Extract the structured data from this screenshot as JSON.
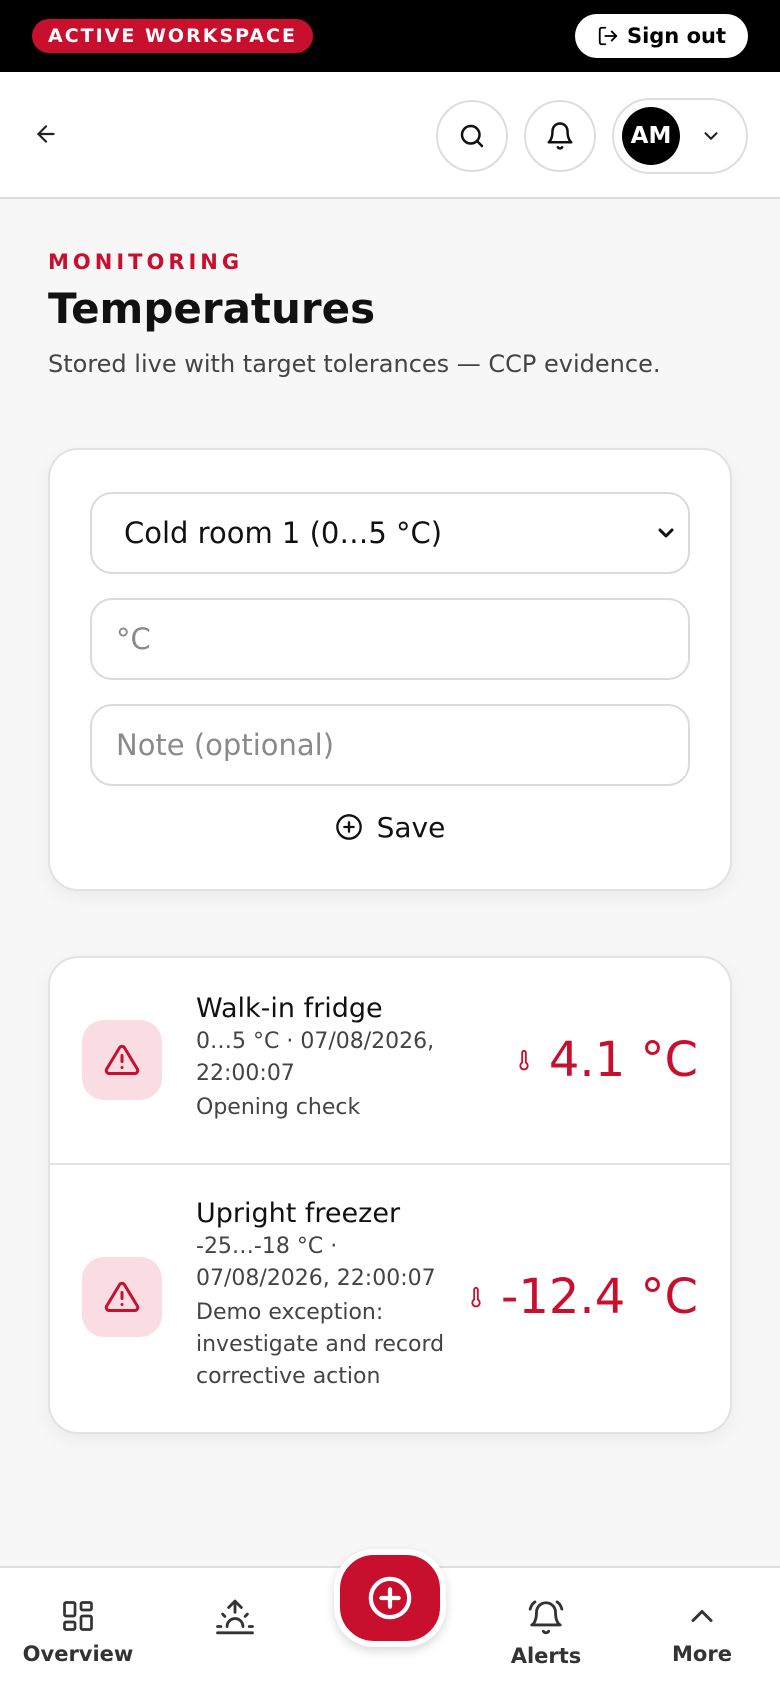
{
  "topbar": {
    "workspace_badge": "ACTIVE WORKSPACE",
    "sign_out_label": "Sign out"
  },
  "header": {
    "avatar_initials": "AM"
  },
  "page": {
    "eyebrow": "MONITORING",
    "title": "Temperatures",
    "subtitle": "Stored live with target tolerances — CCP evidence."
  },
  "form": {
    "selected_unit": "Cold room 1 (0…5 °C)",
    "temperature_placeholder": "°C",
    "note_placeholder": "Note (optional)",
    "save_label": "Save"
  },
  "readings": [
    {
      "name": "Walk-in fridge",
      "range": "0…5 °C · 07/08/2026,",
      "time": "22:00:07",
      "note": "Opening check",
      "value": "4.1 °C"
    },
    {
      "name": "Upright freezer",
      "range": "-25…-18 °C ·",
      "time": "07/08/2026, 22:00:07",
      "note": "Demo exception: investigate and record corrective action",
      "value": "-12.4 °C"
    }
  ],
  "nav": {
    "overview": "Overview",
    "alerts": "Alerts",
    "more": "More"
  },
  "colors": {
    "accent": "#c8102e",
    "warn_bg": "#f9dde2"
  }
}
